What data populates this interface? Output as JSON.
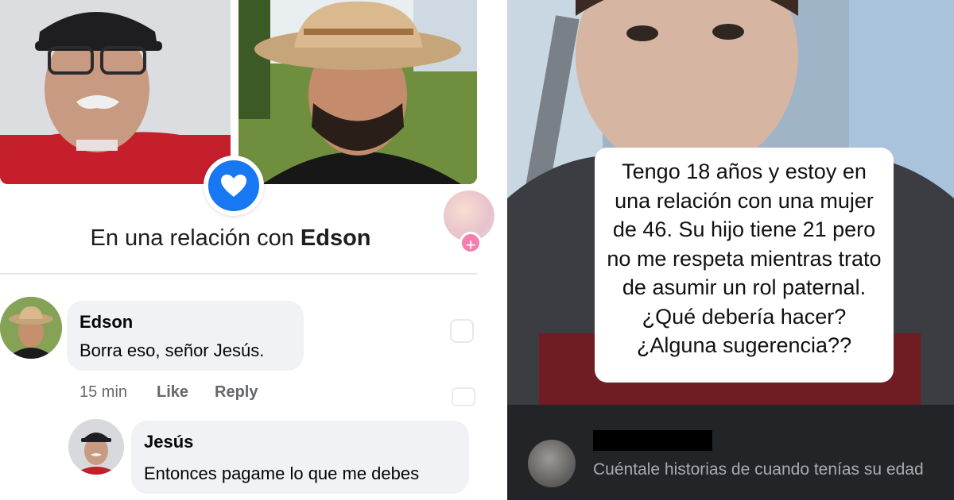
{
  "left_post": {
    "heart_icon": "heart-icon",
    "relationship_prefix": "En una relación con ",
    "relationship_name": "Edson",
    "comments": [
      {
        "author": "Edson",
        "text": "Borra eso, señor Jesús.",
        "time": "15 min",
        "like_label": "Like",
        "reply_label": "Reply"
      },
      {
        "author": "Jesús",
        "text": "Entonces pagame lo que me debes"
      }
    ],
    "colors": {
      "accent": "#1877f2",
      "bubble": "#f0f2f5",
      "meta": "#65676b"
    }
  },
  "right_post": {
    "caption_lines": [
      "Tengo 18 años y estoy en",
      "una relación con una mujer",
      "de 46. Su hijo tiene 21 pero",
      "no me respeta mientras trato",
      "de asumir un rol paternal.",
      "¿Qué debería hacer?",
      "¿Alguna sugerencia??"
    ],
    "comment_text": "Cuéntale historias de cuando tenías su edad",
    "colors": {
      "comment_bar": "#222427",
      "comment_text": "#a8abb0"
    }
  }
}
